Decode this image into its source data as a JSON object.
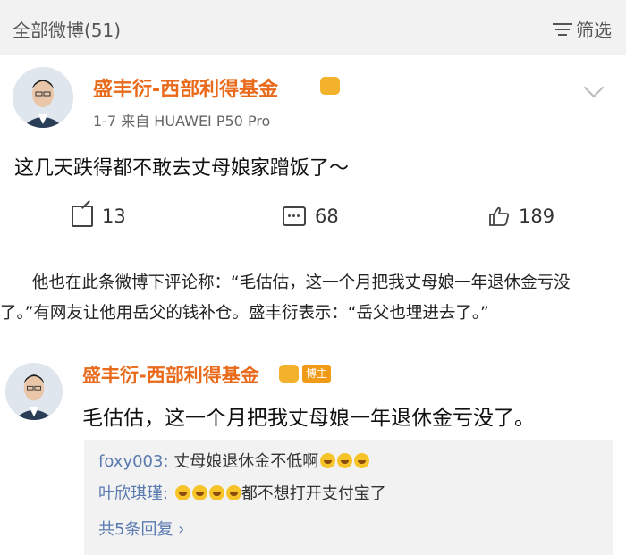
{
  "topbar": {
    "title": "全部微博(51)",
    "filter_label": "筛选"
  },
  "post": {
    "author": "盛丰衍-西部利得基金",
    "meta": "1-7  来自 HUAWEI P50 Pro",
    "text": "这几天跌得都不敢去丈母娘家蹭饭了～",
    "share_count": "13",
    "comment_count": "68",
    "like_count": "189"
  },
  "article": {
    "line1": "他也在此条微博下评论称：“毛估估，这一个月把我丈母娘一年退休金亏没",
    "line2": "了。”有网友让他用岳父的钱补仓。盛丰衍表示：“岳父也埋进去了。”"
  },
  "comment": {
    "author": "盛丰衍-西部利得基金",
    "tag": "博主",
    "text": "毛估估，这一个月把我丈母娘一年退休金亏没了。",
    "replies": [
      {
        "user": "foxy003:",
        "text": "丈母娘退休金不低啊",
        "emoji_count": 3
      },
      {
        "user": "叶欣琪瑾:",
        "text": "都不想打开支付宝了",
        "emoji_count": 4
      }
    ],
    "more_label": "共5条回复 ›"
  },
  "colors": {
    "name": "#e86a1a",
    "link": "#5b7bb0",
    "badge": "#f3b22b"
  }
}
